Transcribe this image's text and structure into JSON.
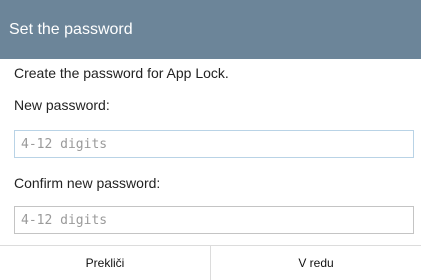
{
  "dialog": {
    "title": "Set the password",
    "description": "Create the password for App Lock.",
    "new_password": {
      "label": "New password:",
      "value": "",
      "placeholder": "4-12 digits"
    },
    "confirm_password": {
      "label": "Confirm new password:",
      "value": "",
      "placeholder": "4-12 digits"
    },
    "buttons": {
      "cancel_label": "Prekliči",
      "ok_label": "V redu"
    }
  },
  "colors": {
    "titlebar": "#6c8599",
    "focus_border": "#b9d3e6"
  }
}
